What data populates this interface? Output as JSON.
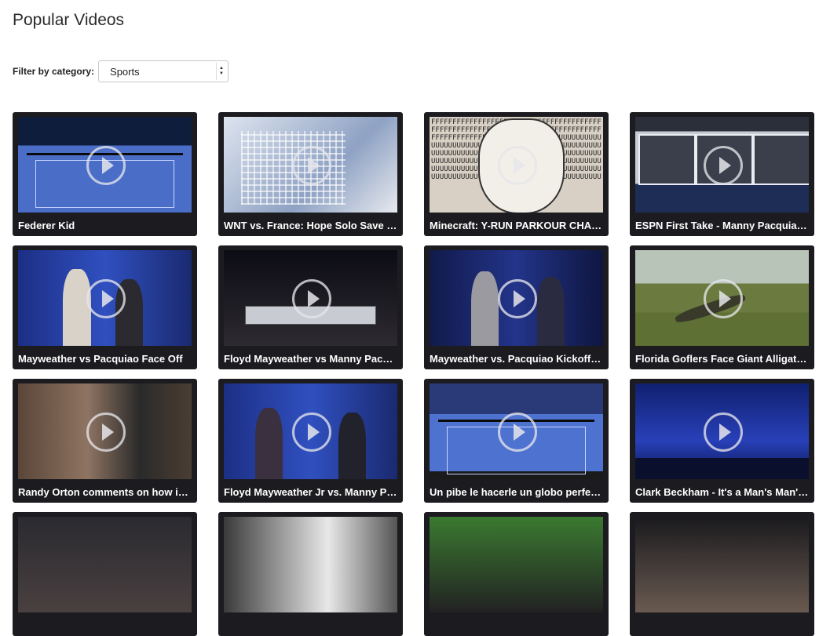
{
  "page": {
    "title": "Popular Videos"
  },
  "filter": {
    "label": "Filter by category:",
    "selected": "Sports"
  },
  "videos": [
    {
      "title": "Federer Kid"
    },
    {
      "title": "WNT vs. France: Hope Solo Save - ..."
    },
    {
      "title": "Minecraft: Y-RUN PARKOUR CHAL..."
    },
    {
      "title": "ESPN First Take - Manny Pacquiao ..."
    },
    {
      "title": "Mayweather vs Pacquiao Face Off"
    },
    {
      "title": "Floyd Mayweather vs Manny Pacqu..."
    },
    {
      "title": "Mayweather vs. Pacquiao Kickoff P..."
    },
    {
      "title": "Florida Goflers Face Giant Alligator ..."
    },
    {
      "title": "Randy Orton comments on how it f..."
    },
    {
      "title": "Floyd Mayweather Jr vs. Manny Pa..."
    },
    {
      "title": "Un pibe le hacerle un globo perfect..."
    },
    {
      "title": "Clark Beckham - It's a Man's Man's ..."
    },
    {
      "title": ""
    },
    {
      "title": ""
    },
    {
      "title": ""
    },
    {
      "title": ""
    }
  ],
  "icons": {
    "play": "play-circle-icon",
    "select_arrows": "chevron-up-down-icon"
  }
}
